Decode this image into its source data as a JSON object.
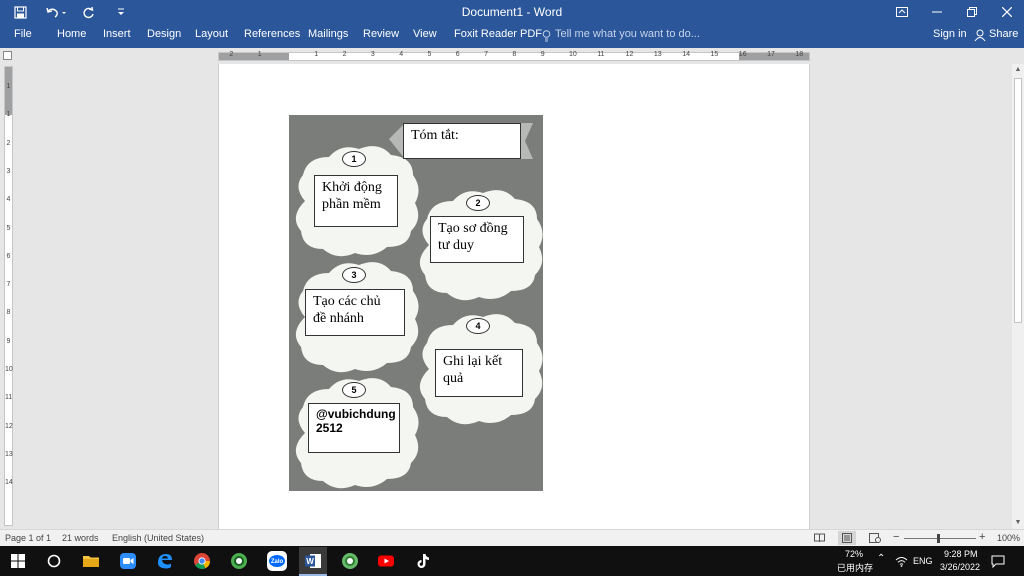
{
  "window": {
    "title": "Document1 - Word"
  },
  "ribbon": {
    "tabs": [
      "File",
      "Home",
      "Insert",
      "Design",
      "Layout",
      "References",
      "Mailings",
      "Review",
      "View",
      "Foxit Reader PDF"
    ],
    "tell_me_placeholder": "Tell me what you want to do...",
    "sign_in": "Sign in",
    "share": "Share"
  },
  "ruler": {
    "numbers": [
      "2",
      "1",
      "1",
      "2",
      "3",
      "4",
      "5",
      "6",
      "7",
      "8",
      "9",
      "10",
      "11",
      "12",
      "13",
      "14",
      "15",
      "16",
      "17",
      "18"
    ],
    "vnumbers": [
      "1",
      "1",
      "2",
      "3",
      "4",
      "5",
      "6",
      "7",
      "8",
      "9",
      "10",
      "11",
      "12",
      "13",
      "14"
    ]
  },
  "document": {
    "summary_label": "Tóm tắt:",
    "steps": [
      {
        "number": "1",
        "text": "Khởi động phần mềm"
      },
      {
        "number": "2",
        "text": "Tạo sơ đồng tư duy"
      },
      {
        "number": "3",
        "text": "Tạo các chủ đề nhánh"
      },
      {
        "number": "4",
        "text": "Ghi lại kết quả"
      },
      {
        "number": "5",
        "text": "@vubichdung 2512"
      }
    ]
  },
  "statusbar": {
    "page": "Page 1 of 1",
    "words": "21 words",
    "language": "English (United States)",
    "zoom": "100%"
  },
  "taskbar": {
    "memory_percent": "72%",
    "memory_label": "已用内存",
    "ime": "ENG",
    "time": "9:28 PM",
    "date": "3/26/2022"
  },
  "colors": {
    "word_blue": "#2b579a",
    "diagram_bg": "#7b7d7a",
    "cloud_fill": "#f3f6f1"
  }
}
